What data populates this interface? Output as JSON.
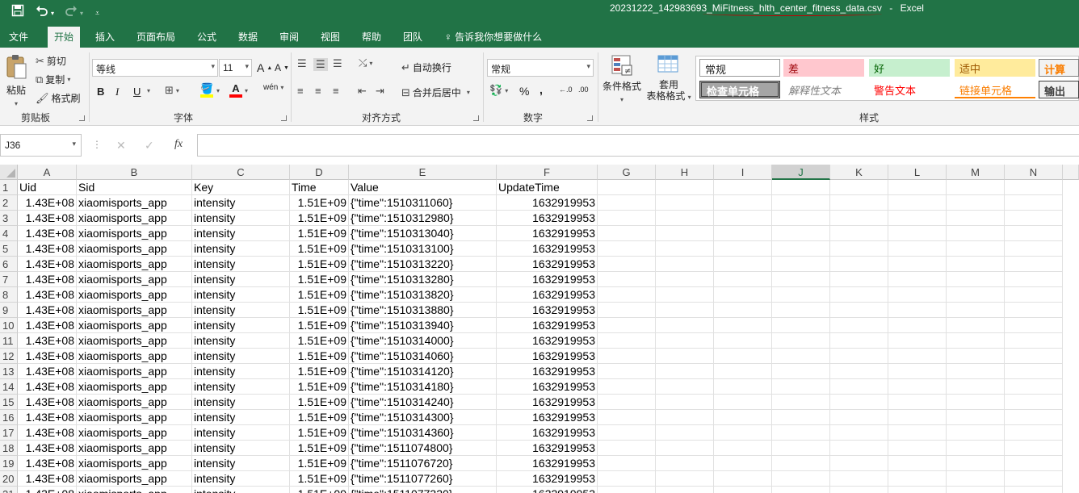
{
  "window": {
    "filename": "20231222_142983693_MiFitness_hlth_center_fitness_data.csv",
    "separator": "-",
    "app": "Excel"
  },
  "qat": {
    "save_icon": "save-icon",
    "undo_icon": "undo-icon",
    "redo_icon": "redo-icon",
    "customize_icon": "customize-icon"
  },
  "tabs": [
    "文件",
    "开始",
    "插入",
    "页面布局",
    "公式",
    "数据",
    "审阅",
    "视图",
    "帮助",
    "团队"
  ],
  "tell_me": "告诉我你想要做什么",
  "ribbon": {
    "clipboard": {
      "paste": "粘贴",
      "cut": "剪切",
      "copy": "复制",
      "format_painter": "格式刷",
      "label": "剪贴板"
    },
    "font": {
      "name": "等线",
      "size": "11",
      "bold": "B",
      "italic": "I",
      "underline": "U",
      "grow": "A",
      "shrink": "A",
      "phonetic": "wén",
      "font_color_letter": "A",
      "highlight_color": "#ffff00",
      "font_color": "#ff0000",
      "label": "字体"
    },
    "alignment": {
      "wrap_text": "自动换行",
      "merge_center": "合并后居中",
      "label": "对齐方式"
    },
    "number": {
      "format": "常规",
      "percent": "%",
      "comma": ",",
      "inc_decimal": "←.0",
      "dec_decimal": ".00",
      "label": "数字"
    },
    "styles": {
      "conditional": "条件格式",
      "table_format_line1": "套用",
      "table_format_line2": "表格格式",
      "items": [
        {
          "label": "常规",
          "bg": "#ffffff",
          "color": "#000000"
        },
        {
          "label": "差",
          "bg": "#ffc7ce",
          "color": "#9c0006"
        },
        {
          "label": "好",
          "bg": "#c6efce",
          "color": "#006100"
        },
        {
          "label": "适中",
          "bg": "#ffeb9c",
          "color": "#9c5700"
        },
        {
          "label": "计算",
          "bg": "#f2f2f2",
          "color": "#fa7d00"
        },
        {
          "label": "检查单元格",
          "bg": "#a5a5a5",
          "color": "#ffffff"
        },
        {
          "label": "解释性文本",
          "bg": "#ffffff",
          "color": "#7f7f7f"
        },
        {
          "label": "警告文本",
          "bg": "#ffffff",
          "color": "#ff0000"
        },
        {
          "label": "链接单元格",
          "bg": "#ffffff",
          "color": "#fa7d00"
        },
        {
          "label": "输出",
          "bg": "#f2f2f2",
          "color": "#3f3f3f"
        }
      ],
      "label": "样式"
    }
  },
  "formula_bar": {
    "cell_ref": "J36",
    "cancel": "✕",
    "enter": "✓",
    "fx": "fx",
    "content": ""
  },
  "sheet": {
    "columns": [
      "A",
      "B",
      "C",
      "D",
      "E",
      "F",
      "G",
      "H",
      "I",
      "J",
      "K",
      "L",
      "M",
      "N"
    ],
    "selected_column": "J",
    "row_numbers": [
      "1",
      "2",
      "3",
      "4",
      "5",
      "6",
      "7",
      "8",
      "9",
      "10",
      "11",
      "12",
      "13",
      "14",
      "15",
      "16",
      "17",
      "18",
      "19",
      "20",
      "21"
    ],
    "header": [
      "Uid",
      "Sid",
      "Key",
      "Time",
      "Value",
      "UpdateTime"
    ],
    "rows": [
      [
        "1.43E+08",
        "xiaomisports_app",
        "intensity",
        "1.51E+09",
        "{\"time\":1510311060}",
        "1632919953"
      ],
      [
        "1.43E+08",
        "xiaomisports_app",
        "intensity",
        "1.51E+09",
        "{\"time\":1510312980}",
        "1632919953"
      ],
      [
        "1.43E+08",
        "xiaomisports_app",
        "intensity",
        "1.51E+09",
        "{\"time\":1510313040}",
        "1632919953"
      ],
      [
        "1.43E+08",
        "xiaomisports_app",
        "intensity",
        "1.51E+09",
        "{\"time\":1510313100}",
        "1632919953"
      ],
      [
        "1.43E+08",
        "xiaomisports_app",
        "intensity",
        "1.51E+09",
        "{\"time\":1510313220}",
        "1632919953"
      ],
      [
        "1.43E+08",
        "xiaomisports_app",
        "intensity",
        "1.51E+09",
        "{\"time\":1510313280}",
        "1632919953"
      ],
      [
        "1.43E+08",
        "xiaomisports_app",
        "intensity",
        "1.51E+09",
        "{\"time\":1510313820}",
        "1632919953"
      ],
      [
        "1.43E+08",
        "xiaomisports_app",
        "intensity",
        "1.51E+09",
        "{\"time\":1510313880}",
        "1632919953"
      ],
      [
        "1.43E+08",
        "xiaomisports_app",
        "intensity",
        "1.51E+09",
        "{\"time\":1510313940}",
        "1632919953"
      ],
      [
        "1.43E+08",
        "xiaomisports_app",
        "intensity",
        "1.51E+09",
        "{\"time\":1510314000}",
        "1632919953"
      ],
      [
        "1.43E+08",
        "xiaomisports_app",
        "intensity",
        "1.51E+09",
        "{\"time\":1510314060}",
        "1632919953"
      ],
      [
        "1.43E+08",
        "xiaomisports_app",
        "intensity",
        "1.51E+09",
        "{\"time\":1510314120}",
        "1632919953"
      ],
      [
        "1.43E+08",
        "xiaomisports_app",
        "intensity",
        "1.51E+09",
        "{\"time\":1510314180}",
        "1632919953"
      ],
      [
        "1.43E+08",
        "xiaomisports_app",
        "intensity",
        "1.51E+09",
        "{\"time\":1510314240}",
        "1632919953"
      ],
      [
        "1.43E+08",
        "xiaomisports_app",
        "intensity",
        "1.51E+09",
        "{\"time\":1510314300}",
        "1632919953"
      ],
      [
        "1.43E+08",
        "xiaomisports_app",
        "intensity",
        "1.51E+09",
        "{\"time\":1510314360}",
        "1632919953"
      ],
      [
        "1.43E+08",
        "xiaomisports_app",
        "intensity",
        "1.51E+09",
        "{\"time\":1511074800}",
        "1632919953"
      ],
      [
        "1.43E+08",
        "xiaomisports_app",
        "intensity",
        "1.51E+09",
        "{\"time\":1511076720}",
        "1632919953"
      ],
      [
        "1.43E+08",
        "xiaomisports_app",
        "intensity",
        "1.51E+09",
        "{\"time\":1511077260}",
        "1632919953"
      ],
      [
        "1.43E+08",
        "xiaomisports_app",
        "intensity",
        "1.51E+09",
        "{\"time\":1511077320}",
        "1632919953"
      ]
    ]
  }
}
